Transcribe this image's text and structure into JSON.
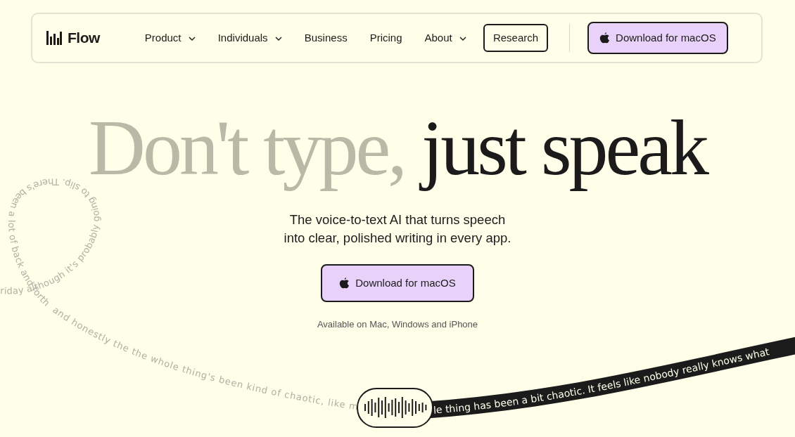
{
  "nav": {
    "logo": "Flow",
    "items": [
      {
        "label": "Product",
        "dropdown": true,
        "kind": "link"
      },
      {
        "label": "Individuals",
        "dropdown": true,
        "kind": "link"
      },
      {
        "label": "Business",
        "dropdown": false,
        "kind": "link"
      },
      {
        "label": "Pricing",
        "dropdown": false,
        "kind": "link"
      },
      {
        "label": "About",
        "dropdown": true,
        "kind": "link"
      },
      {
        "label": "Research",
        "dropdown": false,
        "kind": "outlined"
      }
    ],
    "cta": "Download for macOS"
  },
  "hero": {
    "title_muted": "Don't type,",
    "title_strong": "just speak",
    "subtitle": "The voice-to-text AI that turns speech\ninto clear, polished writing in every app.",
    "cta": "Download for macOS",
    "availability": "Available on Mac, Windows and iPhone"
  },
  "transcript": {
    "faded_loop": "riday although it's probably going to slip. There's been a lot of back and forth",
    "faded_tail": "and honestly the the whole thing's been kind of chaotic, like m",
    "highlighted": "le thing has been a bit chaotic. It feels like nobody really knows what"
  }
}
